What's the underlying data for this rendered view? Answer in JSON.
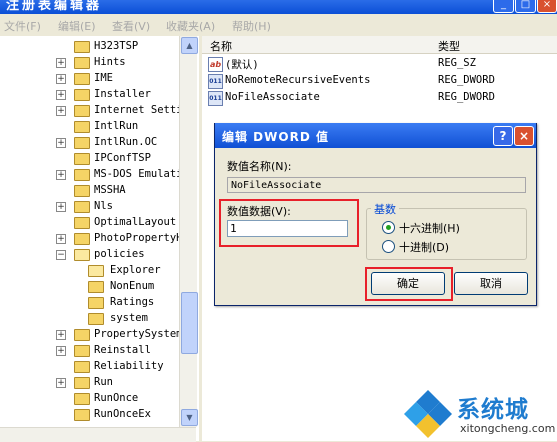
{
  "window": {
    "title": "注册表编辑器"
  },
  "menu": [
    "文件(F)",
    "编辑(E)",
    "查看(V)",
    "收藏夹(A)",
    "帮助(H)"
  ],
  "tree": [
    {
      "label": "H323TSP",
      "expander": ""
    },
    {
      "label": "Hints",
      "expander": "+"
    },
    {
      "label": "IME",
      "expander": "+"
    },
    {
      "label": "Installer",
      "expander": "+"
    },
    {
      "label": "Internet Setti",
      "expander": "+"
    },
    {
      "label": "IntlRun",
      "expander": ""
    },
    {
      "label": "IntlRun.OC",
      "expander": "+"
    },
    {
      "label": "IPConfTSP",
      "expander": ""
    },
    {
      "label": "MS-DOS Emulati",
      "expander": "+"
    },
    {
      "label": "MSSHA",
      "expander": ""
    },
    {
      "label": "Nls",
      "expander": "+"
    },
    {
      "label": "OptimalLayout",
      "expander": ""
    },
    {
      "label": "PhotoPropertyH",
      "expander": "+"
    },
    {
      "label": "policies",
      "expander": "−",
      "open": true
    },
    {
      "label": "Explorer",
      "expander": "",
      "indent": 1,
      "open": true
    },
    {
      "label": "NonEnum",
      "expander": "",
      "indent": 1
    },
    {
      "label": "Ratings",
      "expander": "",
      "indent": 1
    },
    {
      "label": "system",
      "expander": "",
      "indent": 1
    },
    {
      "label": "PropertySystem",
      "expander": "+"
    },
    {
      "label": "Reinstall",
      "expander": "+"
    },
    {
      "label": "Reliability",
      "expander": ""
    },
    {
      "label": "Run",
      "expander": "+"
    },
    {
      "label": "RunOnce",
      "expander": ""
    },
    {
      "label": "RunOnceEx",
      "expander": ""
    }
  ],
  "list": {
    "headers": {
      "name": "名称",
      "type": "类型"
    },
    "rows": [
      {
        "icon": "string-value-icon",
        "icon_text": "ab",
        "name": "(默认)",
        "type": "REG_SZ"
      },
      {
        "icon": "binary-value-icon",
        "icon_text": "011",
        "name": "NoRemoteRecursiveEvents",
        "type": "REG_DWORD"
      },
      {
        "icon": "binary-value-icon",
        "icon_text": "011",
        "name": "NoFileAssociate",
        "type": "REG_DWORD"
      }
    ]
  },
  "dialog": {
    "title": "编辑 DWORD 值",
    "help": "?",
    "close": "×",
    "name_label": "数值名称(N):",
    "name_value": "NoFileAssociate",
    "data_label": "数值数据(V):",
    "data_value": "1",
    "base_legend": "基数",
    "hex_label": "十六进制(H)",
    "dec_label": "十进制(D)",
    "ok": "确定",
    "cancel": "取消"
  },
  "watermark": {
    "brand": "系统城",
    "url": "xitongcheng.com"
  },
  "colors": {
    "highlight": "#e8202a",
    "titlebar": "#0b4fd6",
    "folder": "#f5d466"
  }
}
